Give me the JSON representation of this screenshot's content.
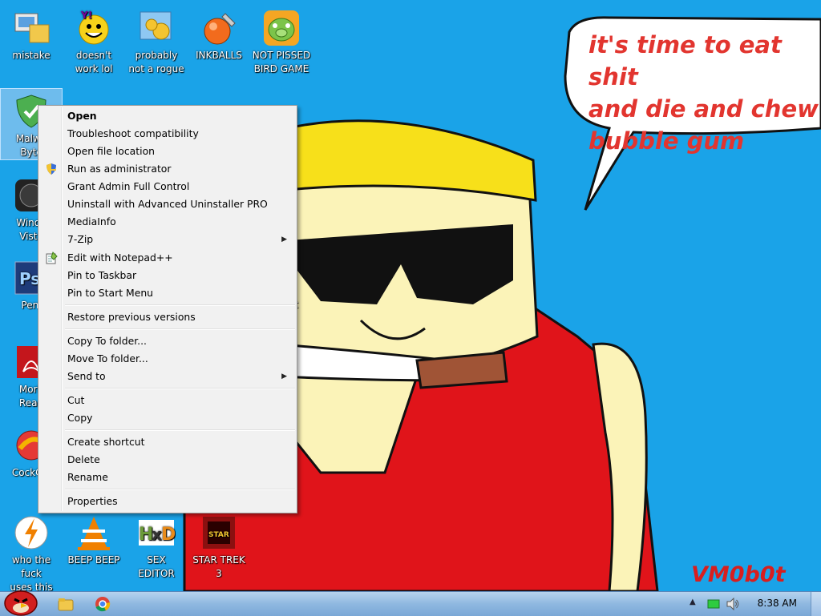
{
  "wallpaper": {
    "speech": "it's time to eat shit\nand die and chew\nbubble gum",
    "signature": "VM0b0t"
  },
  "desktop_icons": [
    {
      "label": "mistake",
      "icon": "computer-folder-icon"
    },
    {
      "label": "doesn't\nwork lol",
      "icon": "yahoo-messenger-icon"
    },
    {
      "label": "probably\nnot a rogue",
      "icon": "control-panel-icon"
    },
    {
      "label": "INKBALLS",
      "icon": "inkball-icon"
    },
    {
      "label": "NOT PISSED\nBIRD GAME",
      "icon": "green-pig-icon"
    },
    {
      "label": "Malwa\nByte",
      "icon": "shield-icon"
    },
    {
      "label": "Windo\nVista",
      "icon": "vista-orb-icon"
    },
    {
      "label": "Peni",
      "icon": "photoshop-icon"
    },
    {
      "label": "Morb\nRead",
      "icon": "acrobat-icon"
    },
    {
      "label": "CockCle",
      "icon": "ccleaner-icon"
    },
    {
      "label": "who the fuck\nuses this",
      "icon": "winamp-icon"
    },
    {
      "label": "BEEP BEEP",
      "icon": "vlc-icon"
    },
    {
      "label": "SEX\nEDITOR",
      "icon": "hxd-icon"
    },
    {
      "label": "STAR TREK\n3",
      "icon": "star-wars-icon"
    }
  ],
  "partial_labels": [
    "bt",
    "xt"
  ],
  "context_menu": {
    "items": [
      {
        "label": "Open",
        "bold": true
      },
      {
        "label": "Troubleshoot compatibility"
      },
      {
        "label": "Open file location"
      },
      {
        "label": "Run as administrator",
        "icon": "uac-shield-icon"
      },
      {
        "label": "Grant Admin Full Control"
      },
      {
        "label": "Uninstall with Advanced Uninstaller PRO"
      },
      {
        "label": "MediaInfo"
      },
      {
        "label": "7-Zip",
        "submenu": true
      },
      {
        "label": "Edit with Notepad++",
        "icon": "notepad-plus-icon"
      },
      {
        "label": "Pin to Taskbar"
      },
      {
        "label": "Pin to Start Menu"
      },
      {
        "label": "Restore previous versions"
      },
      {
        "label": "Copy To folder..."
      },
      {
        "label": "Move To folder..."
      },
      {
        "label": "Send to",
        "submenu": true
      },
      {
        "label": "Cut"
      },
      {
        "label": "Copy"
      },
      {
        "label": "Create shortcut"
      },
      {
        "label": "Delete"
      },
      {
        "label": "Rename"
      },
      {
        "label": "Properties"
      }
    ]
  },
  "taskbar": {
    "start_icon": "angry-bird-start-icon",
    "pinned": [
      "explorer-icon",
      "chrome-icon"
    ],
    "tray": [
      "show-hidden-icons-icon",
      "network-icon",
      "volume-icon"
    ],
    "clock": "8:38 AM"
  },
  "colors": {
    "desktop_bg": "#1aa3e8",
    "speech_text": "#e2352f",
    "shirt": "#e0141a",
    "hat": "#f7e01a",
    "skin": "#fbf3b8"
  }
}
